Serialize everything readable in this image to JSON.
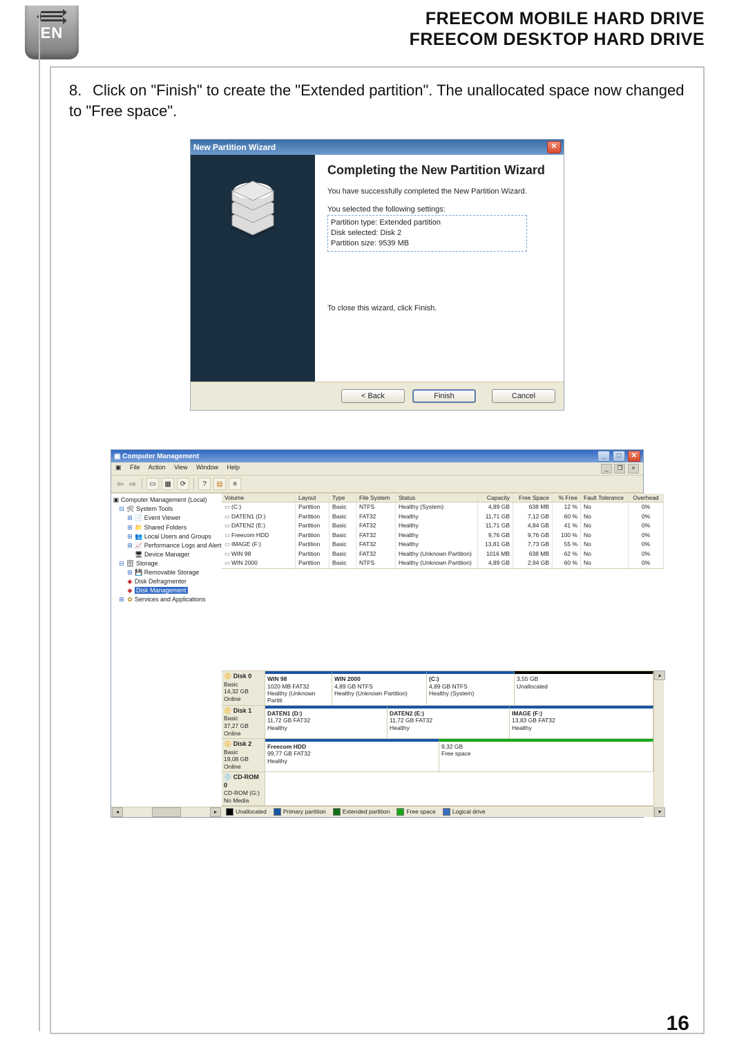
{
  "badge": {
    "lang": "EN"
  },
  "header": {
    "line1": "FREECOM MOBILE HARD DRIVE",
    "line2": "FREECOM DESKTOP HARD DRIVE"
  },
  "step": {
    "number": "8.",
    "text": "Click on \"Finish\" to create the \"Extended partition\". The unallocated space now changed to \"Free space\"."
  },
  "wizard": {
    "title": "New Partition Wizard",
    "heading": "Completing the New Partition Wizard",
    "completed": "You have successfully completed the New Partition Wizard.",
    "settings_label": "You selected the following settings:",
    "settings": {
      "type": "Partition type: Extended partition",
      "disk": "Disk selected: Disk 2",
      "size": "Partition size: 9539 MB"
    },
    "close_hint": "To close this wizard, click Finish.",
    "buttons": {
      "back": "< Back",
      "finish": "Finish",
      "cancel": "Cancel"
    }
  },
  "cm": {
    "title": "Computer Management",
    "menu": {
      "file": "File",
      "action": "Action",
      "view": "View",
      "window": "Window",
      "help": "Help"
    },
    "tree": {
      "root": "Computer Management (Local)",
      "system_tools": "System Tools",
      "event_viewer": "Event Viewer",
      "shared_folders": "Shared Folders",
      "local_users": "Local Users and Groups",
      "perf": "Performance Logs and Alerts",
      "device_mgr": "Device Manager",
      "storage": "Storage",
      "removable": "Removable Storage",
      "defrag": "Disk Defragmenter",
      "disk_mgmt": "Disk Management",
      "services": "Services and Applications"
    },
    "columns": {
      "volume": "Volume",
      "layout": "Layout",
      "type": "Type",
      "fs": "File System",
      "status": "Status",
      "cap": "Capacity",
      "free": "Free Space",
      "pfree": "% Free",
      "ft": "Fault Tolerance",
      "oh": "Overhead"
    },
    "volumes": [
      {
        "v": "(C:)",
        "layout": "Partition",
        "type": "Basic",
        "fs": "NTFS",
        "status": "Healthy (System)",
        "cap": "4,89 GB",
        "free": "638 MB",
        "pfree": "12 %",
        "ft": "No",
        "oh": "0%"
      },
      {
        "v": "DATEN1 (D:)",
        "layout": "Partition",
        "type": "Basic",
        "fs": "FAT32",
        "status": "Healthy",
        "cap": "11,71 GB",
        "free": "7,12 GB",
        "pfree": "60 %",
        "ft": "No",
        "oh": "0%"
      },
      {
        "v": "DATEN2 (E:)",
        "layout": "Partition",
        "type": "Basic",
        "fs": "FAT32",
        "status": "Healthy",
        "cap": "11,71 GB",
        "free": "4,84 GB",
        "pfree": "41 %",
        "ft": "No",
        "oh": "0%"
      },
      {
        "v": "Freecom HDD",
        "layout": "Partition",
        "type": "Basic",
        "fs": "FAT32",
        "status": "Healthy",
        "cap": "9,76 GB",
        "free": "9,76 GB",
        "pfree": "100 %",
        "ft": "No",
        "oh": "0%"
      },
      {
        "v": "IMAGE (F:)",
        "layout": "Partition",
        "type": "Basic",
        "fs": "FAT32",
        "status": "Healthy",
        "cap": "13,81 GB",
        "free": "7,73 GB",
        "pfree": "55 %",
        "ft": "No",
        "oh": "0%"
      },
      {
        "v": "WIN 98",
        "layout": "Partition",
        "type": "Basic",
        "fs": "FAT32",
        "status": "Healthy (Unknown Partition)",
        "cap": "1016 MB",
        "free": "638 MB",
        "pfree": "62 %",
        "ft": "No",
        "oh": "0%"
      },
      {
        "v": "WIN 2000",
        "layout": "Partition",
        "type": "Basic",
        "fs": "NTFS",
        "status": "Healthy (Unknown Partition)",
        "cap": "4,89 GB",
        "free": "2,94 GB",
        "pfree": "60 %",
        "ft": "No",
        "oh": "0%"
      }
    ],
    "disks": {
      "d0": {
        "name": "Disk 0",
        "type": "Basic",
        "size": "14,32 GB",
        "state": "Online",
        "parts": [
          {
            "title": "WIN 98",
            "line": "1020 MB FAT32",
            "status": "Healthy (Unknown Partiti",
            "bar": "blue"
          },
          {
            "title": "WIN 2000",
            "line": "4,89 GB NTFS",
            "status": "Healthy (Unknown Partition)",
            "bar": "blue"
          },
          {
            "title": "(C:)",
            "line": "4,89 GB NTFS",
            "status": "Healthy (System)",
            "bar": "blue"
          },
          {
            "title": "",
            "line": "3,55 GB",
            "status": "Unallocated",
            "bar": "black"
          }
        ]
      },
      "d1": {
        "name": "Disk 1",
        "type": "Basic",
        "size": "37,27 GB",
        "state": "Online",
        "parts": [
          {
            "title": "DATEN1 (D:)",
            "line": "11,72 GB FAT32",
            "status": "Healthy",
            "bar": "blue"
          },
          {
            "title": "DATEN2 (E:)",
            "line": "11,72 GB FAT32",
            "status": "Healthy",
            "bar": "blue"
          },
          {
            "title": "IMAGE (F:)",
            "line": "13,83 GB FAT32",
            "status": "Healthy",
            "bar": "blue"
          }
        ]
      },
      "d2": {
        "name": "Disk 2",
        "type": "Basic",
        "size": "19,08 GB",
        "state": "Online",
        "parts": [
          {
            "title": "Freecom HDD",
            "line": "99,77 GB FAT32",
            "status": "Healthy",
            "bar": "blue"
          },
          {
            "title": "",
            "line": "9,32 GB",
            "status": "Free space",
            "bar": "green"
          }
        ]
      },
      "cd": {
        "name": "CD-ROM 0",
        "type": "CD-ROM (G:)",
        "size": "",
        "state": "No Media"
      }
    },
    "legend": {
      "unalloc": "Unallocated",
      "primary": "Primary partition",
      "extended": "Extended partition",
      "free": "Free space",
      "logical": "Logical drive"
    }
  },
  "page_number": "16"
}
